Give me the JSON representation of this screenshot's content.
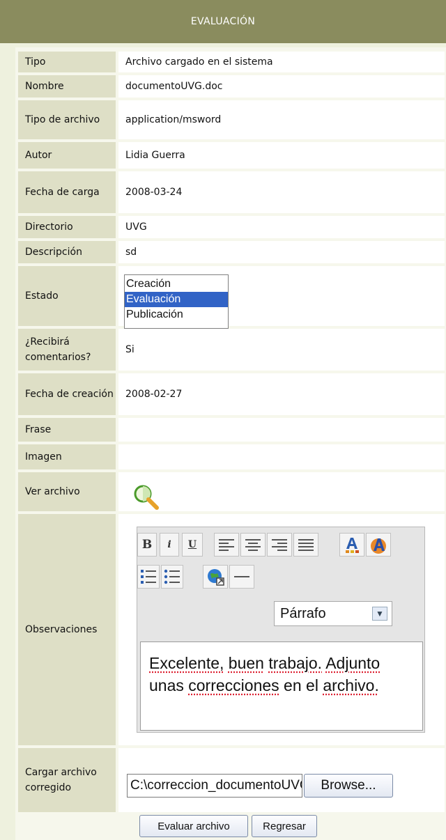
{
  "header": {
    "title": "EVALUACIÓN"
  },
  "fields": {
    "tipo": {
      "label": "Tipo",
      "value": "Archivo cargado en el sistema"
    },
    "nombre": {
      "label": "Nombre",
      "value": "documentoUVG.doc"
    },
    "tipo_archivo": {
      "label": "Tipo de archivo",
      "value": "application/msword"
    },
    "autor": {
      "label": "Autor",
      "value": "Lidia Guerra"
    },
    "fecha_carga": {
      "label": "Fecha de carga",
      "value": "2008-03-24"
    },
    "directorio": {
      "label": "Directorio",
      "value": "UVG"
    },
    "descripcion": {
      "label": "Descripción",
      "value": "sd"
    },
    "estado": {
      "label": "Estado",
      "options": [
        "Creación",
        "Evaluación",
        "Publicación"
      ],
      "selected": "Evaluación"
    },
    "comentarios": {
      "label": "¿Recibirá comentarios?",
      "value": "Si"
    },
    "fecha_creacion": {
      "label": "Fecha de creación",
      "value": "2008-02-27"
    },
    "frase": {
      "label": "Frase",
      "value": ""
    },
    "imagen": {
      "label": "Imagen",
      "value": ""
    },
    "ver_archivo": {
      "label": "Ver archivo",
      "icon": "magnifier-icon"
    },
    "observaciones": {
      "label": "Observaciones",
      "toolbar": {
        "bold": "B",
        "italic": "i",
        "underline": "U",
        "format_value": "Párrafo"
      },
      "content_words": [
        "Excelente,",
        "buen",
        "trabajo.",
        "Adjunto",
        "unas",
        "correcciones",
        "en",
        "el",
        "archivo."
      ]
    },
    "cargar": {
      "label": "Cargar archivo corregido",
      "path_value": "C:\\correccion_documentoUVG.doc",
      "browse_label": "Browse..."
    }
  },
  "actions": {
    "evaluar_label": "Evaluar archivo",
    "regresar_label": "Regresar"
  },
  "colors": {
    "header": "#8a8c5e",
    "label_bg": "#dedfc6",
    "selection": "#3163c6"
  }
}
